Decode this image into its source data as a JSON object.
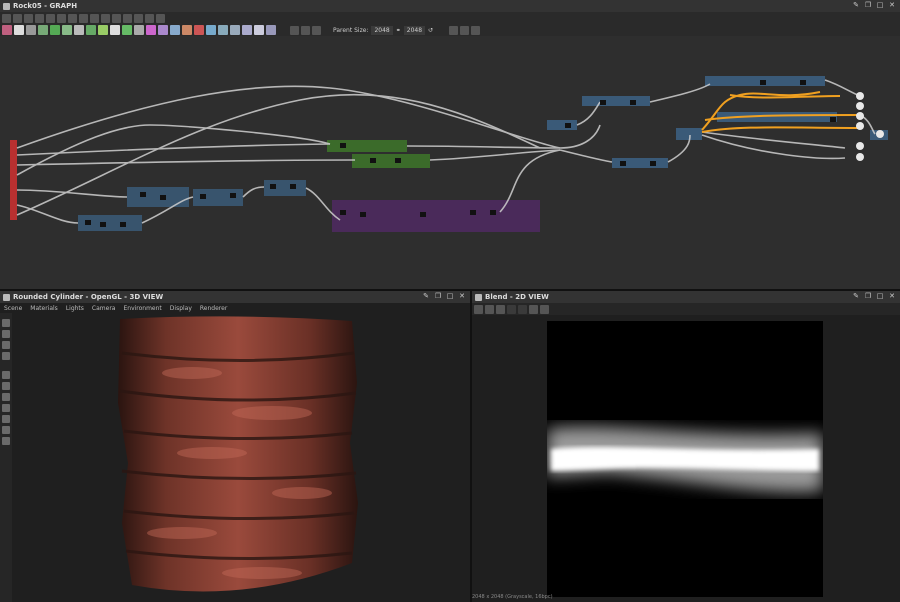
{
  "graph_panel": {
    "title": "Rock05 - GRAPH",
    "parent_size_label": "Parent Size:",
    "parent_size_value": "2048",
    "output_size_value": "2048"
  },
  "view3d_panel": {
    "title": "Rounded Cylinder - OpenGL - 3D VIEW",
    "menu": [
      "Scene",
      "Materials",
      "Lights",
      "Camera",
      "Environment",
      "Display",
      "Renderer"
    ]
  },
  "view2d_panel": {
    "title": "Blend - 2D VIEW",
    "status": "2048 x 2048 (Grayscale, 16bpc)"
  },
  "colors": {
    "accent_orange": "#f0a020",
    "frame_blue": "#3a5a78",
    "frame_green": "#3b6b2a",
    "frame_purple": "#4a2a5a",
    "input_red": "#b83030"
  }
}
